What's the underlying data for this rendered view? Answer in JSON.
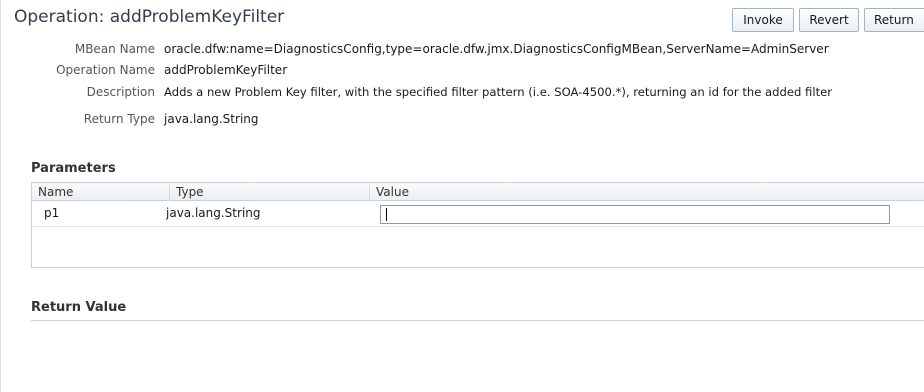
{
  "title": "Operation: addProblemKeyFilter",
  "toolbar": {
    "invoke_label": "Invoke",
    "revert_label": "Revert",
    "return_label": "Return"
  },
  "properties": {
    "mbean_name_label": "MBean Name",
    "mbean_name_value": "oracle.dfw:name=DiagnosticsConfig,type=oracle.dfw.jmx.DiagnosticsConfigMBean,ServerName=AdminServer",
    "operation_name_label": "Operation Name",
    "operation_name_value": "addProblemKeyFilter",
    "description_label": "Description",
    "description_value": "Adds a new Problem Key filter, with the specified filter pattern (i.e. SOA-4500.*), returning an id for the added filter",
    "return_type_label": "Return Type",
    "return_type_value": "java.lang.String"
  },
  "parameters": {
    "section_title": "Parameters",
    "columns": [
      "Name",
      "Type",
      "Value"
    ],
    "rows": [
      {
        "name": "p1",
        "type": "java.lang.String",
        "value": ""
      }
    ]
  },
  "return_value": {
    "section_title": "Return Value"
  }
}
